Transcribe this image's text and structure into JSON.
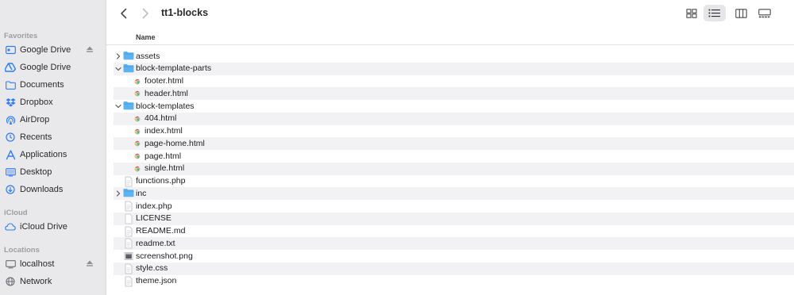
{
  "window": {
    "title": "tt1-blocks"
  },
  "sidebar": {
    "sections": [
      {
        "title": "Favorites",
        "items": [
          {
            "label": "Google Drive",
            "icon": "drive-disk-icon",
            "eject": true
          },
          {
            "label": "Google Drive",
            "icon": "google-drive-icon"
          },
          {
            "label": "Documents",
            "icon": "documents-folder-icon"
          },
          {
            "label": "Dropbox",
            "icon": "dropbox-icon"
          },
          {
            "label": "AirDrop",
            "icon": "airdrop-icon"
          },
          {
            "label": "Recents",
            "icon": "clock-icon"
          },
          {
            "label": "Applications",
            "icon": "applications-icon"
          },
          {
            "label": "Desktop",
            "icon": "desktop-icon"
          },
          {
            "label": "Downloads",
            "icon": "download-icon"
          }
        ]
      },
      {
        "title": "iCloud",
        "items": [
          {
            "label": "iCloud Drive",
            "icon": "cloud-icon"
          }
        ]
      },
      {
        "title": "Locations",
        "items": [
          {
            "label": "localhost",
            "icon": "computer-icon",
            "eject": true
          },
          {
            "label": "Network",
            "icon": "network-globe-icon"
          }
        ]
      }
    ]
  },
  "column_header": {
    "name": "Name"
  },
  "files": [
    {
      "name": "assets",
      "type": "folder",
      "level": 0,
      "expanded": false
    },
    {
      "name": "block-template-parts",
      "type": "folder",
      "level": 0,
      "expanded": true
    },
    {
      "name": "footer.html",
      "type": "html",
      "level": 1
    },
    {
      "name": "header.html",
      "type": "html",
      "level": 1
    },
    {
      "name": "block-templates",
      "type": "folder",
      "level": 0,
      "expanded": true
    },
    {
      "name": "404.html",
      "type": "html",
      "level": 1
    },
    {
      "name": "index.html",
      "type": "html",
      "level": 1
    },
    {
      "name": "page-home.html",
      "type": "html",
      "level": 1
    },
    {
      "name": "page.html",
      "type": "html",
      "level": 1
    },
    {
      "name": "single.html",
      "type": "html",
      "level": 1
    },
    {
      "name": "functions.php",
      "type": "doc",
      "level": 0
    },
    {
      "name": "inc",
      "type": "folder",
      "level": 0,
      "expanded": false
    },
    {
      "name": "index.php",
      "type": "doc",
      "level": 0
    },
    {
      "name": "LICENSE",
      "type": "blank",
      "level": 0
    },
    {
      "name": "README.md",
      "type": "doc",
      "level": 0
    },
    {
      "name": "readme.txt",
      "type": "doc",
      "level": 0
    },
    {
      "name": "screenshot.png",
      "type": "image",
      "level": 0
    },
    {
      "name": "style.css",
      "type": "doc",
      "level": 0
    },
    {
      "name": "theme.json",
      "type": "doc",
      "level": 0
    }
  ],
  "colors": {
    "accent": "#2f7cf6",
    "folder": "#5db3f0",
    "sidebar_bg": "#e9e8ea",
    "stripe": "#f2f2f4"
  }
}
